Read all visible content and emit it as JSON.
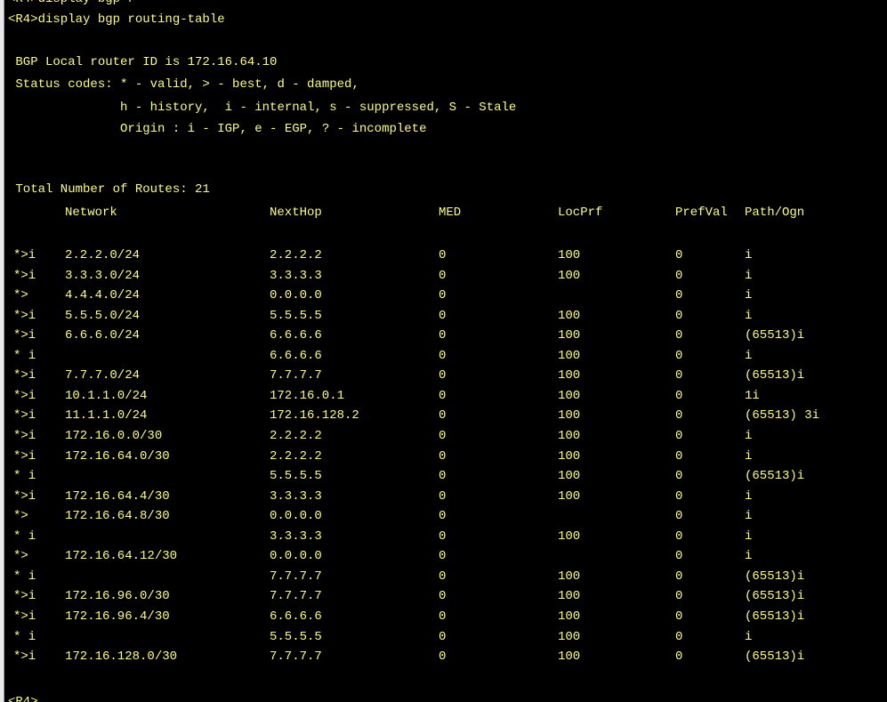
{
  "terminal": {
    "top_partial": "<R4>display bgp r",
    "command": "<R4>display bgp routing-table",
    "router_id": " BGP Local router ID is 172.16.64.10",
    "status_codes_1": " Status codes: * - valid, > - best, d - damped,",
    "status_codes_2": "               h - history,  i - internal, s - suppressed, S - Stale",
    "status_codes_3": "               Origin : i - IGP, e - EGP, ? - incomplete",
    "total_routes": " Total Number of Routes: 21",
    "bottom_prompt": "<R4>"
  },
  "table": {
    "headers": {
      "network": "Network",
      "nexthop": "NextHop",
      "med": "MED",
      "locprf": "LocPrf",
      "prefval": "PrefVal",
      "path": "Path/Ogn"
    },
    "rows": [
      {
        "status": "*>i",
        "network": "2.2.2.0/24",
        "nexthop": "2.2.2.2",
        "med": "0",
        "locprf": "100",
        "prefval": "0",
        "path": "i"
      },
      {
        "status": "*>i",
        "network": "3.3.3.0/24",
        "nexthop": "3.3.3.3",
        "med": "0",
        "locprf": "100",
        "prefval": "0",
        "path": "i"
      },
      {
        "status": "*>",
        "network": "4.4.4.0/24",
        "nexthop": "0.0.0.0",
        "med": "0",
        "locprf": "",
        "prefval": "0",
        "path": "i"
      },
      {
        "status": "*>i",
        "network": "5.5.5.0/24",
        "nexthop": "5.5.5.5",
        "med": "0",
        "locprf": "100",
        "prefval": "0",
        "path": "i"
      },
      {
        "status": "*>i",
        "network": "6.6.6.0/24",
        "nexthop": "6.6.6.6",
        "med": "0",
        "locprf": "100",
        "prefval": "0",
        "path": "(65513)i"
      },
      {
        "status": "* i",
        "network": "",
        "nexthop": "6.6.6.6",
        "med": "0",
        "locprf": "100",
        "prefval": "0",
        "path": "i"
      },
      {
        "status": "*>i",
        "network": "7.7.7.0/24",
        "nexthop": "7.7.7.7",
        "med": "0",
        "locprf": "100",
        "prefval": "0",
        "path": "(65513)i"
      },
      {
        "status": "*>i",
        "network": "10.1.1.0/24",
        "nexthop": "172.16.0.1",
        "med": "0",
        "locprf": "100",
        "prefval": "0",
        "path": "1i"
      },
      {
        "status": "*>i",
        "network": "11.1.1.0/24",
        "nexthop": "172.16.128.2",
        "med": "0",
        "locprf": "100",
        "prefval": "0",
        "path": "(65513) 3i"
      },
      {
        "status": "*>i",
        "network": "172.16.0.0/30",
        "nexthop": "2.2.2.2",
        "med": "0",
        "locprf": "100",
        "prefval": "0",
        "path": "i"
      },
      {
        "status": "*>i",
        "network": "172.16.64.0/30",
        "nexthop": "2.2.2.2",
        "med": "0",
        "locprf": "100",
        "prefval": "0",
        "path": "i"
      },
      {
        "status": "* i",
        "network": "",
        "nexthop": "5.5.5.5",
        "med": "0",
        "locprf": "100",
        "prefval": "0",
        "path": "(65513)i"
      },
      {
        "status": "*>i",
        "network": "172.16.64.4/30",
        "nexthop": "3.3.3.3",
        "med": "0",
        "locprf": "100",
        "prefval": "0",
        "path": "i"
      },
      {
        "status": "*>",
        "network": "172.16.64.8/30",
        "nexthop": "0.0.0.0",
        "med": "0",
        "locprf": "",
        "prefval": "0",
        "path": "i"
      },
      {
        "status": "* i",
        "network": "",
        "nexthop": "3.3.3.3",
        "med": "0",
        "locprf": "100",
        "prefval": "0",
        "path": "i"
      },
      {
        "status": "*>",
        "network": "172.16.64.12/30",
        "nexthop": "0.0.0.0",
        "med": "0",
        "locprf": "",
        "prefval": "0",
        "path": "i"
      },
      {
        "status": "* i",
        "network": "",
        "nexthop": "7.7.7.7",
        "med": "0",
        "locprf": "100",
        "prefval": "0",
        "path": "(65513)i"
      },
      {
        "status": "*>i",
        "network": "172.16.96.0/30",
        "nexthop": "7.7.7.7",
        "med": "0",
        "locprf": "100",
        "prefval": "0",
        "path": "(65513)i"
      },
      {
        "status": "*>i",
        "network": "172.16.96.4/30",
        "nexthop": "6.6.6.6",
        "med": "0",
        "locprf": "100",
        "prefval": "0",
        "path": "(65513)i"
      },
      {
        "status": "* i",
        "network": "",
        "nexthop": "5.5.5.5",
        "med": "0",
        "locprf": "100",
        "prefval": "0",
        "path": "i"
      },
      {
        "status": "*>i",
        "network": "172.16.128.0/30",
        "nexthop": "7.7.7.7",
        "med": "0",
        "locprf": "100",
        "prefval": "0",
        "path": "(65513)i"
      }
    ]
  },
  "colors": {
    "background": "#000000",
    "text": "#fffd7e",
    "window_border": "#e8e8e8"
  }
}
